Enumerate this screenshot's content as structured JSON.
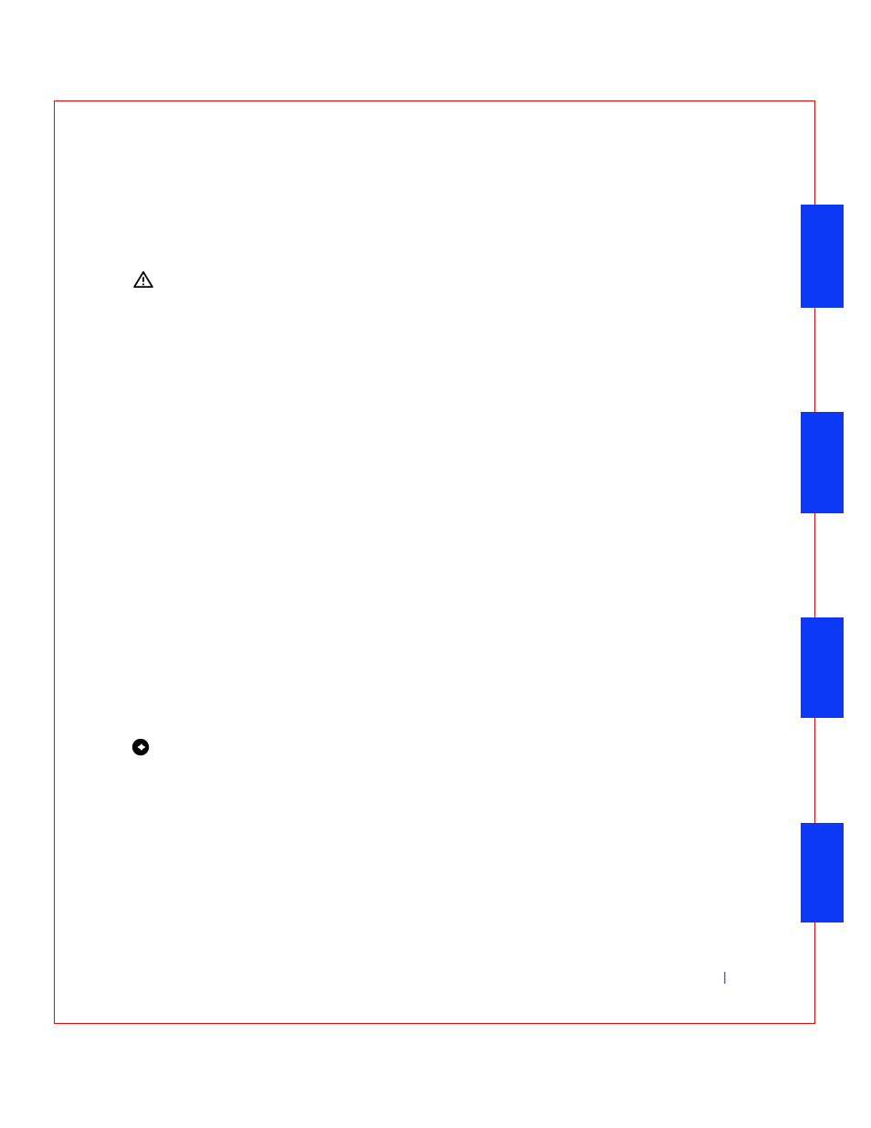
{
  "footer": {
    "separator": "|"
  },
  "colors": {
    "border": "#ff0000",
    "tab": "#0b39f5",
    "icon": "#000000"
  },
  "icons": {
    "warning": "warning-triangle-icon",
    "notice": "notice-circle-arrow-icon"
  }
}
